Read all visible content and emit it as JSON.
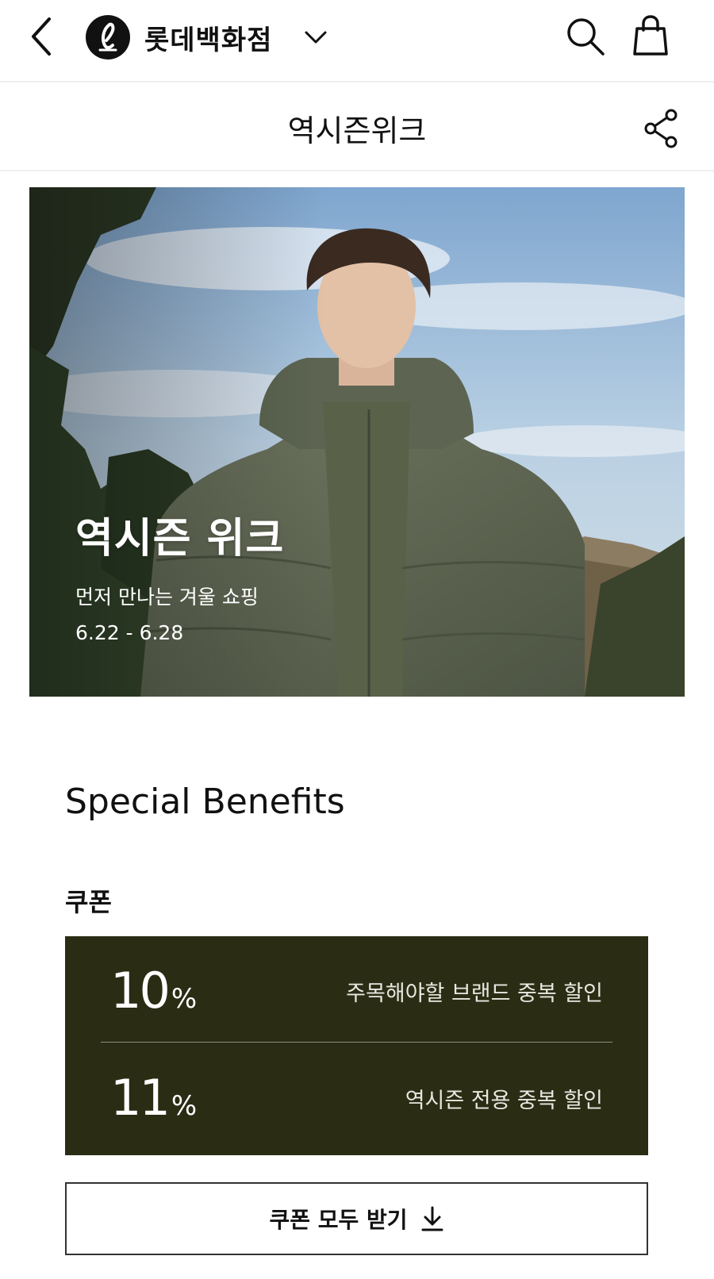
{
  "header": {
    "brand_name": "롯데백화점",
    "icons": {
      "back": "chevron-left-icon",
      "logo": "lotte-logo-icon",
      "brand_menu": "chevron-down-icon",
      "search": "search-icon",
      "cart": "shopping-bag-icon"
    }
  },
  "page": {
    "title": "역시즌위크",
    "share_icon": "share-icon"
  },
  "hero": {
    "title": "역시즌 위크",
    "subtitle": "먼저 만나는 겨울 쇼핑",
    "date_range": "6.22 - 6.28"
  },
  "benefits": {
    "title": "Special Benefits",
    "coupon_heading": "쿠폰",
    "coupons": [
      {
        "value": "10",
        "unit": "%",
        "description": "주목해야할 브랜드 중복 할인"
      },
      {
        "value": "11",
        "unit": "%",
        "description": "역시즌 전용 중복 할인"
      }
    ],
    "download_all_label": "쿠폰 모두 받기",
    "download_icon": "download-icon"
  },
  "colors": {
    "coupon_background": "#2a2c14",
    "text_primary": "#111111",
    "border": "#efefef"
  }
}
